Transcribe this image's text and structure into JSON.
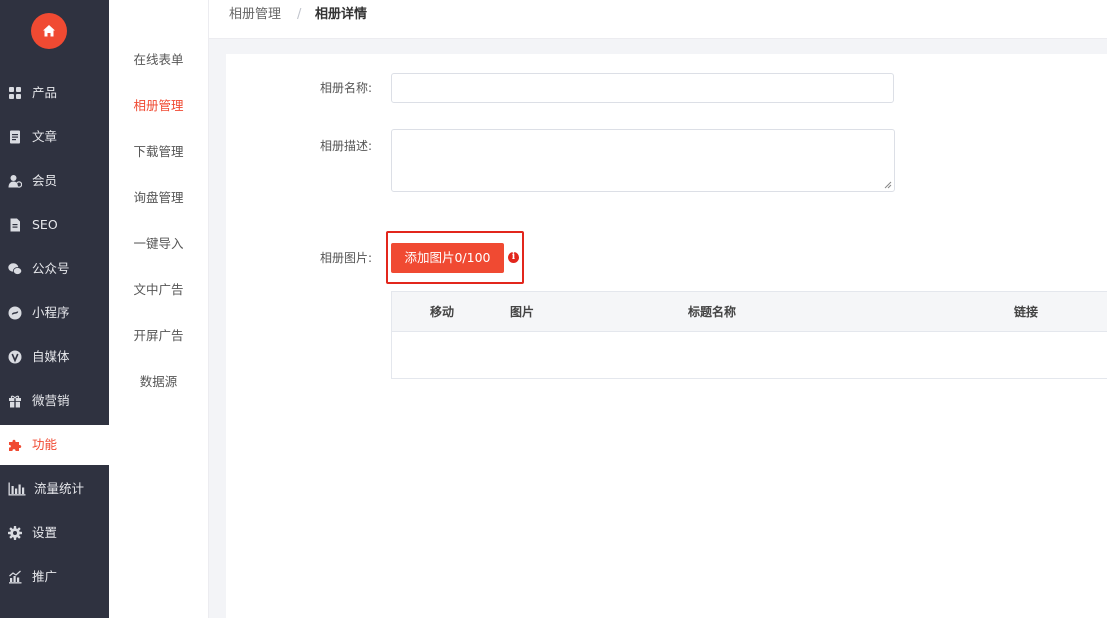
{
  "sidebar": {
    "logo_icon": "home-icon",
    "brand_color": "#f04a32",
    "items": [
      {
        "label": "产品",
        "icon": "grid-icon"
      },
      {
        "label": "文章",
        "icon": "document-icon"
      },
      {
        "label": "会员",
        "icon": "member-icon"
      },
      {
        "label": "SEO",
        "icon": "seo-file-icon"
      },
      {
        "label": "公众号",
        "icon": "wechat-icon"
      },
      {
        "label": "小程序",
        "icon": "miniprogram-icon"
      },
      {
        "label": "自媒体",
        "icon": "v-icon"
      },
      {
        "label": "微营销",
        "icon": "gift-icon"
      },
      {
        "label": "功能",
        "icon": "puzzle-icon",
        "active": true
      },
      {
        "label": "流量统计",
        "icon": "bar-chart-icon"
      },
      {
        "label": "设置",
        "icon": "gear-icon"
      },
      {
        "label": "推广",
        "icon": "promote-chart-icon"
      }
    ]
  },
  "submenu": {
    "items": [
      {
        "label": "在线表单"
      },
      {
        "label": "相册管理",
        "active": true
      },
      {
        "label": "下载管理"
      },
      {
        "label": "询盘管理"
      },
      {
        "label": "一键导入"
      },
      {
        "label": "文中广告"
      },
      {
        "label": "开屏广告"
      },
      {
        "label": "数据源"
      }
    ]
  },
  "breadcrumb": {
    "parent": "相册管理",
    "separator": "/",
    "current": "相册详情"
  },
  "form": {
    "name_label": "相册名称:",
    "name_value": "",
    "desc_label": "相册描述:",
    "desc_value": "",
    "images_label": "相册图片:",
    "add_button": "添加图片0/100",
    "info_icon": "info-icon",
    "highlight_color": "#e2261c"
  },
  "table": {
    "headers": [
      "移动",
      "图片",
      "标题名称",
      "链接"
    ],
    "rows": []
  }
}
